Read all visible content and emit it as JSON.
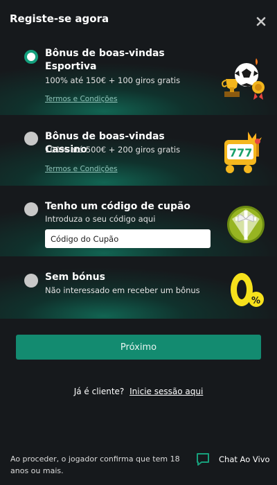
{
  "header": {
    "title": "Registe-se agora",
    "close_icon": "close-icon"
  },
  "options": [
    {
      "title_line1": "Bônus de boas-vindas",
      "title_line2": "Esportiva",
      "description": "100% até 150€ + 100 giros gratis",
      "terms": "Termos e Condições",
      "selected": true,
      "icon": "soccer-ball-trophy-icon"
    },
    {
      "title": "Bônus de boas-vindas Cassino",
      "description": "100% até 500€ + 200 giros gratis",
      "terms": "Termos e Condições",
      "selected": false,
      "icon": "slot-machine-777-icon"
    },
    {
      "title": "Tenho um código de cupão",
      "description": "Introduza o seu código aqui",
      "input_placeholder": "Código do Cupão",
      "selected": false,
      "icon": "gift-box-icon"
    },
    {
      "title": "Sem bónus",
      "description": "Não interessado em receber um bônus",
      "selected": false,
      "icon": "zero-percent-icon"
    }
  ],
  "next_button": "Próximo",
  "login": {
    "question": "Já é cliente?",
    "link": "Inicie sessão aqui"
  },
  "footer": {
    "disclaimer": "Ao proceder, o jogador confirma que tem 18 anos ou mais.",
    "chat_label": "Chat Ao Vivo",
    "chat_icon": "chat-bubble-icon"
  },
  "colors": {
    "background": "#16191c",
    "accent": "#138b70",
    "radio_selected": "#139f7d",
    "link": "#8fc3b8"
  }
}
